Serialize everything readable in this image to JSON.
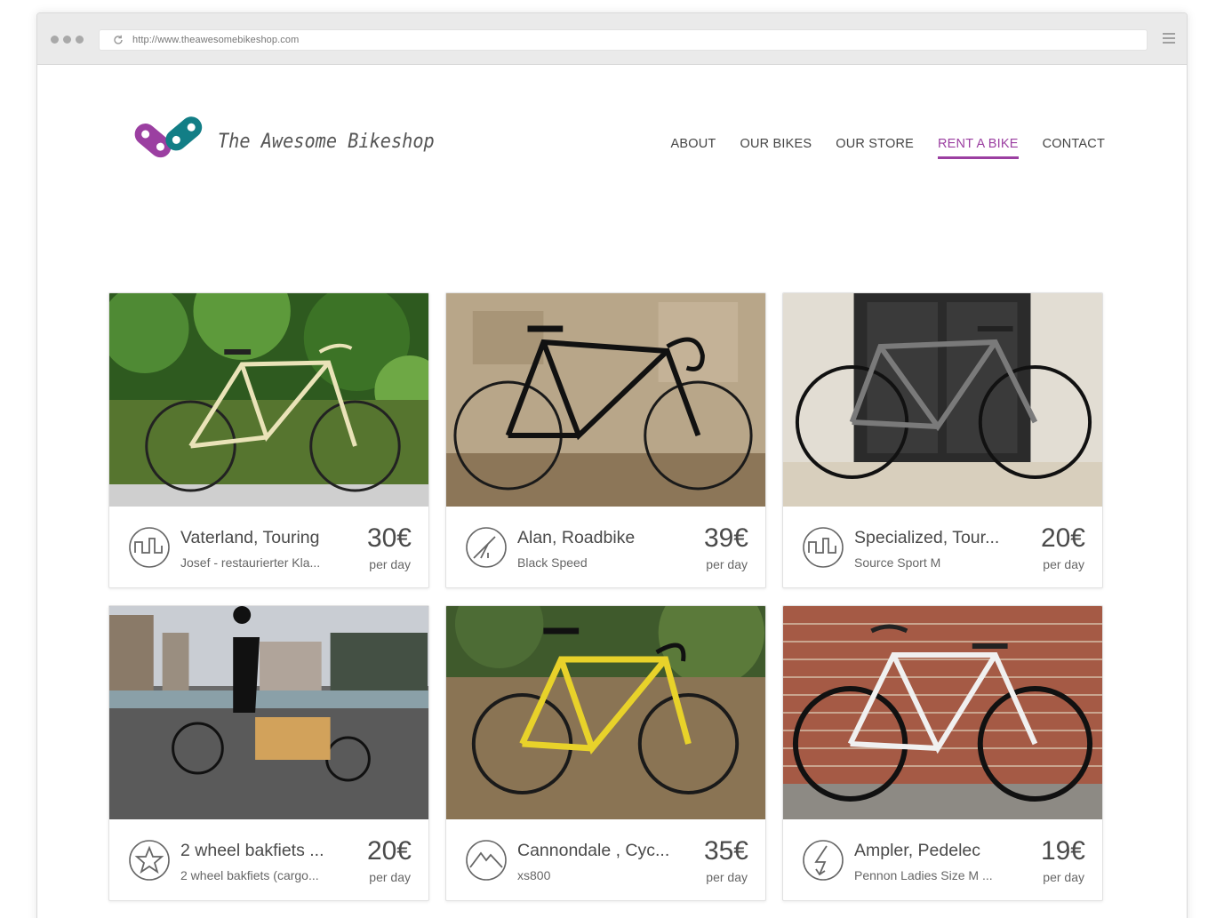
{
  "browser": {
    "url": "http://www.theawesomebikeshop.com"
  },
  "brand": {
    "name": "The Awesome Bikeshop",
    "colors": {
      "purple": "#9b3fa1",
      "teal": "#127e86"
    }
  },
  "nav": {
    "items": [
      {
        "label": "ABOUT",
        "active": false
      },
      {
        "label": "OUR BIKES",
        "active": false
      },
      {
        "label": "OUR STORE",
        "active": false
      },
      {
        "label": "RENT A BIKE",
        "active": true
      },
      {
        "label": "CONTACT",
        "active": false
      }
    ]
  },
  "bikes": [
    {
      "title": "Vaterland, Touring",
      "subtitle": "Josef - restaurierter Kla...",
      "price": "30€",
      "per": "per day",
      "icon": "touring-icon"
    },
    {
      "title": "Alan, Roadbike",
      "subtitle": "Black Speed",
      "price": "39€",
      "per": "per day",
      "icon": "roadbike-icon"
    },
    {
      "title": "Specialized, Tour...",
      "subtitle": "Source Sport M",
      "price": "20€",
      "per": "per day",
      "icon": "touring-icon"
    },
    {
      "title": "2 wheel bakfiets ...",
      "subtitle": "2 wheel bakfiets (cargo...",
      "price": "20€",
      "per": "per day",
      "icon": "cargo-star-icon"
    },
    {
      "title": "Cannondale , Cyc...",
      "subtitle": "xs800",
      "price": "35€",
      "per": "per day",
      "icon": "mountain-icon"
    },
    {
      "title": "Ampler, Pedelec",
      "subtitle": "Pennon Ladies Size M ...",
      "price": "19€",
      "per": "per day",
      "icon": "lightning-icon"
    }
  ]
}
